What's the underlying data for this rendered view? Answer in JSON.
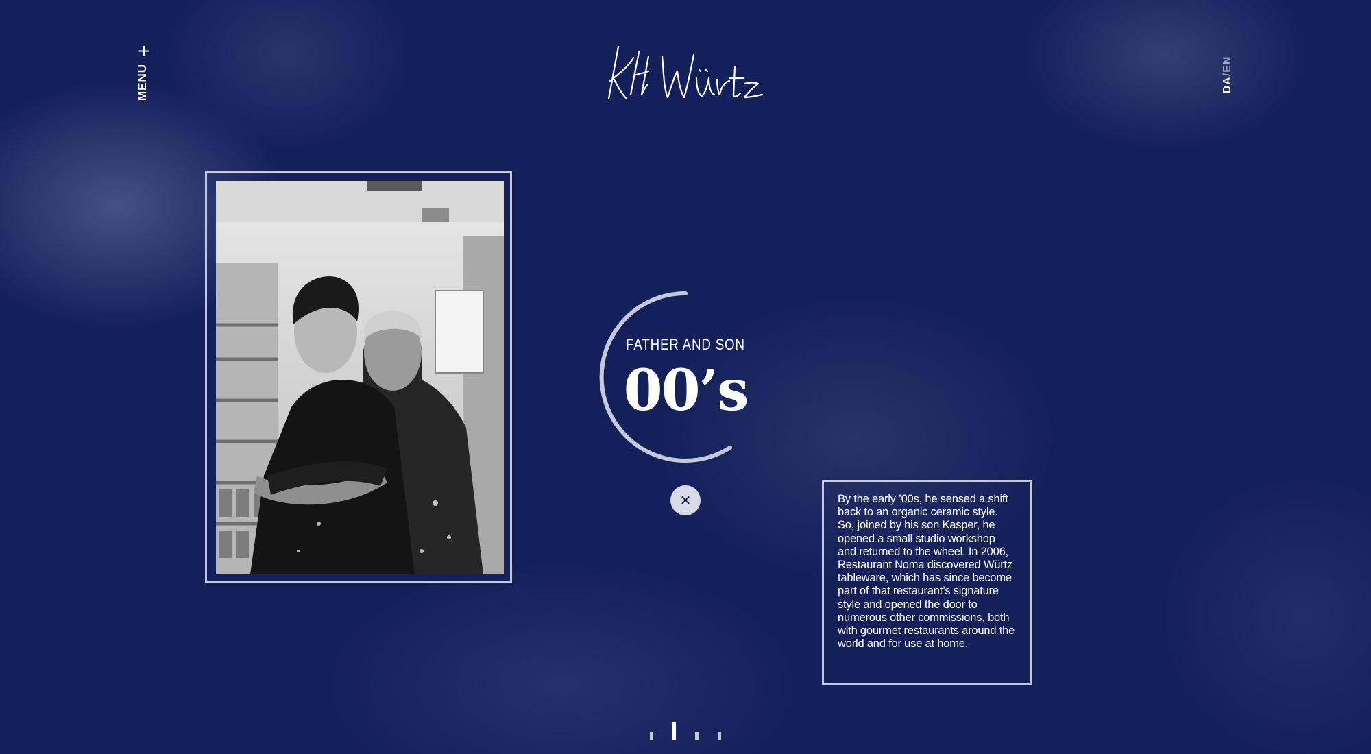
{
  "header": {
    "menu_label": "MENU",
    "menu_icon": "plus-icon",
    "menu_plus": "+",
    "logo_alt": "KH Würtz signature",
    "lang_da": "DA",
    "lang_sep": "/",
    "lang_en": "EN"
  },
  "era": {
    "subtitle": "FATHER AND SON",
    "title": "00’s",
    "close_icon": "close-icon",
    "close_glyph": "✕"
  },
  "story": {
    "text": "By the early ’00s, he sensed a shift back to an organic ceramic style. So, joined by his son Kasper, he opened a small studio workshop and returned to the wheel. In 2006, Restaurant Noma discovered Würtz tableware, which has since become part of that restaurant’s signature style and opened the door to numerous other commissions, both with gourmet restaurants around the world and for use at home."
  },
  "pager": {
    "count": 4,
    "active_index": 1
  },
  "colors": {
    "background": "#14205a",
    "frame": "#c4c9dc",
    "text": "#ffffff",
    "muted": "#9aa3c8"
  }
}
